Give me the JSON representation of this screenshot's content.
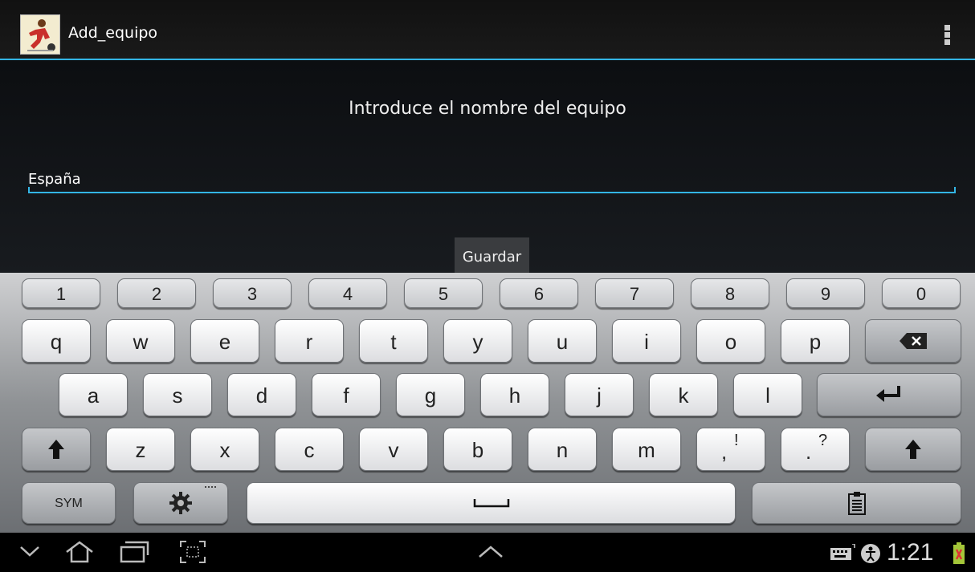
{
  "actionbar": {
    "title": "Add_equipo",
    "icon": "app-icon-soccer-player",
    "overflow_icon": "overflow-menu-icon"
  },
  "form": {
    "prompt": "Introduce el nombre del equipo",
    "input_value": "España",
    "save_label": "Guardar"
  },
  "keyboard": {
    "row1": [
      "1",
      "2",
      "3",
      "4",
      "5",
      "6",
      "7",
      "8",
      "9",
      "0"
    ],
    "row2": [
      "q",
      "w",
      "e",
      "r",
      "t",
      "y",
      "u",
      "i",
      "o",
      "p"
    ],
    "row3": [
      "a",
      "s",
      "d",
      "f",
      "g",
      "h",
      "j",
      "k",
      "l"
    ],
    "row4": [
      "z",
      "x",
      "c",
      "v",
      "b",
      "n",
      "m"
    ],
    "comma_main": ",",
    "comma_alt": "!",
    "period_main": ".",
    "period_alt": "?",
    "sym_label": "SYM",
    "icons": {
      "backspace": "backspace-icon",
      "enter": "enter-icon",
      "shift": "shift-icon",
      "settings": "gear-icon",
      "space": "space-icon",
      "clipboard": "clipboard-icon"
    }
  },
  "systembar": {
    "time": "1:21",
    "icons": [
      "back-icon",
      "home-icon",
      "recents-icon",
      "screenshot-icon",
      "keyboard-status-icon",
      "accessibility-icon",
      "battery-icon"
    ]
  },
  "colors": {
    "accent": "#33b5e5",
    "battery": "#a4c639"
  }
}
